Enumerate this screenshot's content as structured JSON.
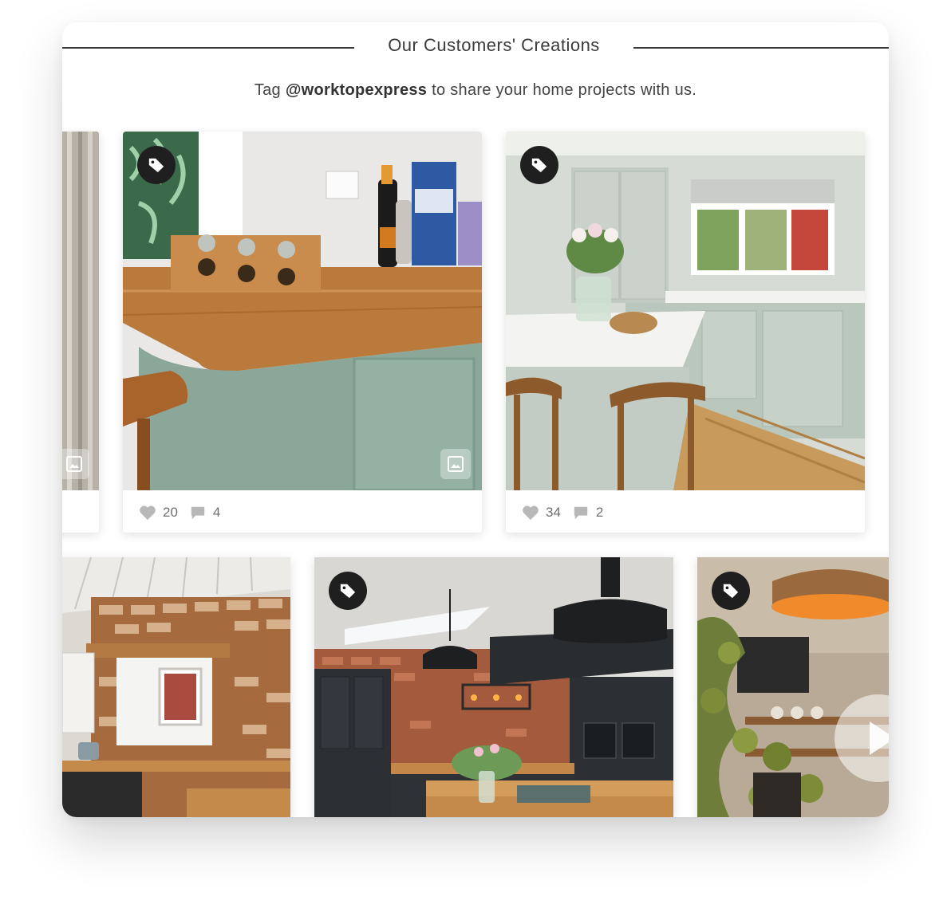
{
  "header": {
    "title": "Our Customers' Creations",
    "subtitle_prefix": "Tag ",
    "handle": "@worktopexpress",
    "subtitle_suffix": " to share your home projects with us."
  },
  "posts": [
    {
      "likes": "20",
      "comments": "4"
    },
    {
      "likes": "34",
      "comments": "2"
    }
  ],
  "icons": {
    "tag": "tag-icon",
    "gallery": "gallery-icon",
    "like": "heart-icon",
    "comment": "comment-icon",
    "play": "play-icon"
  },
  "colors": {
    "rule": "#3a3a3a",
    "tag_button": "#1f1f1f",
    "meta_text": "#6f6f6f"
  }
}
